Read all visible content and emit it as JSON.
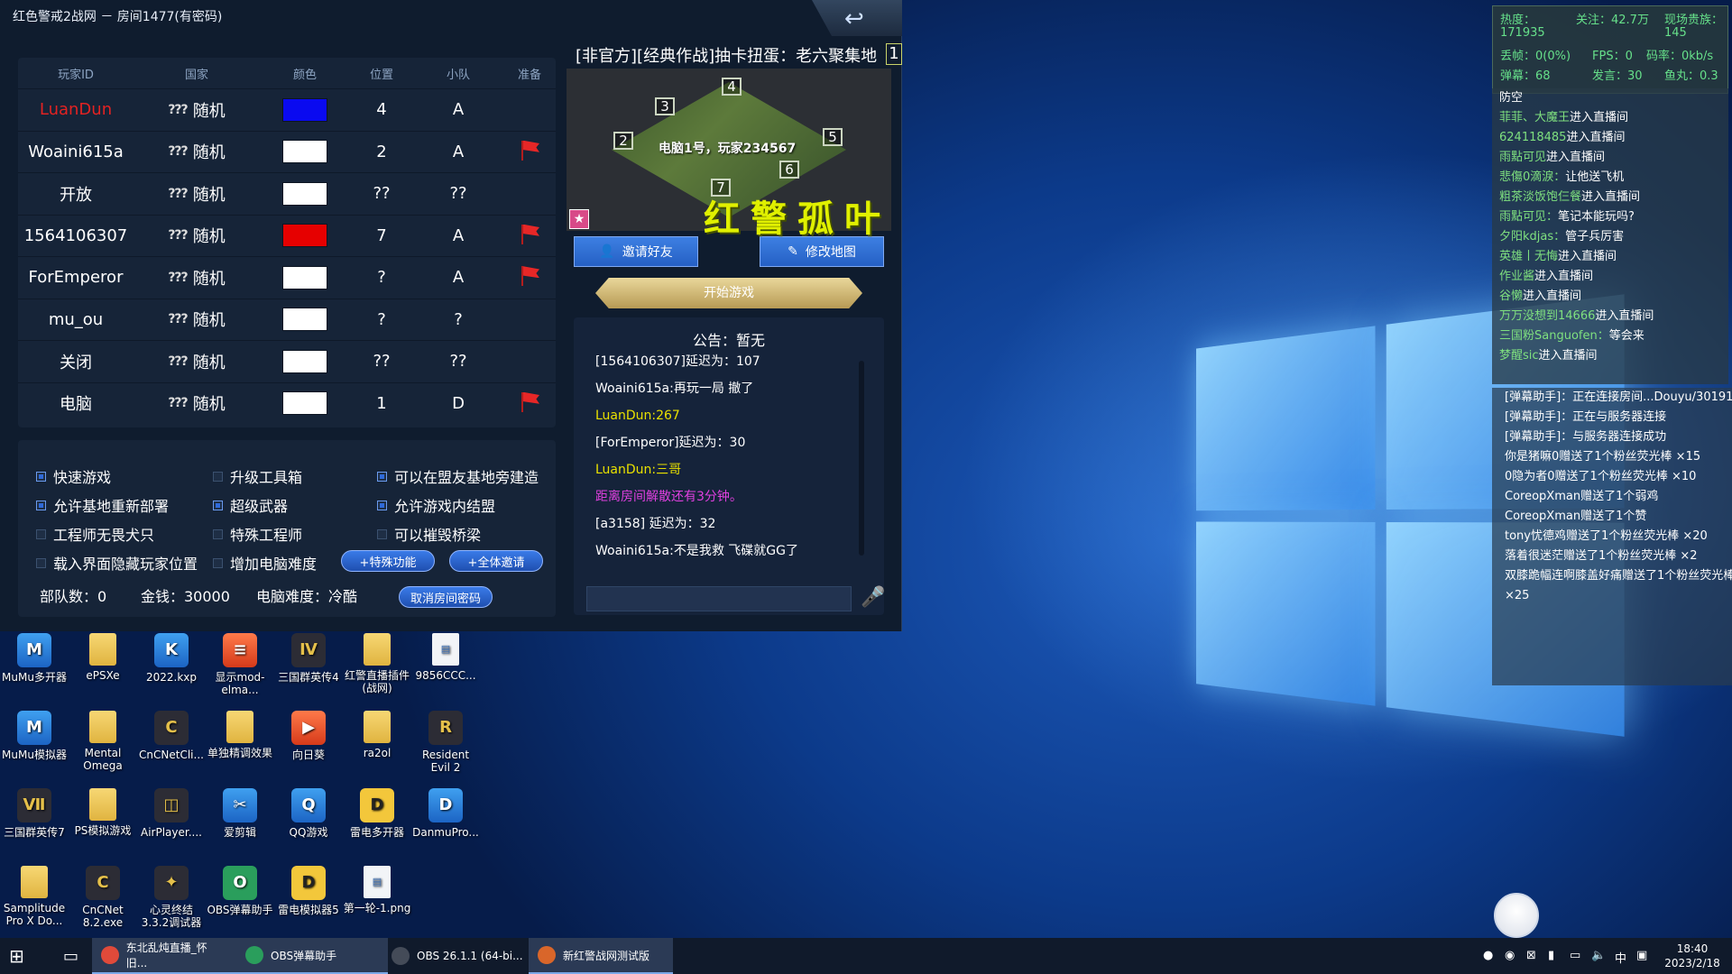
{
  "window": {
    "title": "红色警戒2战网 － 房间1477(有密码)"
  },
  "players": {
    "headers": [
      "玩家ID",
      "国家",
      "颜色",
      "位置",
      "小队",
      "准备"
    ],
    "rows": [
      {
        "id": "LuanDun",
        "country_icon": "???",
        "country": "随机",
        "color": "#0a0af0",
        "pos": "4",
        "team": "A",
        "ready": false,
        "id_color": "#e32222"
      },
      {
        "id": "Woaini615a",
        "country_icon": "???",
        "country": "随机",
        "color": "#ffffff",
        "pos": "2",
        "team": "A",
        "ready": true,
        "id_color": "#ffffff"
      },
      {
        "id": "开放",
        "country_icon": "???",
        "country": "随机",
        "color": "#ffffff",
        "pos": "??",
        "team": "??",
        "ready": false,
        "id_color": "#ffffff"
      },
      {
        "id": "1564106307",
        "country_icon": "???",
        "country": "随机",
        "color": "#e60000",
        "pos": "7",
        "team": "A",
        "ready": true,
        "id_color": "#ffffff"
      },
      {
        "id": "ForEmperor",
        "country_icon": "???",
        "country": "随机",
        "color": "#ffffff",
        "pos": "?",
        "team": "A",
        "ready": true,
        "id_color": "#ffffff"
      },
      {
        "id": "mu_ou",
        "country_icon": "???",
        "country": "随机",
        "color": "#ffffff",
        "pos": "?",
        "team": "?",
        "ready": false,
        "id_color": "#ffffff"
      },
      {
        "id": "关闭",
        "country_icon": "???",
        "country": "随机",
        "color": "#ffffff",
        "pos": "??",
        "team": "??",
        "ready": false,
        "id_color": "#ffffff"
      },
      {
        "id": "电脑",
        "country_icon": "???",
        "country": "随机",
        "color": "#ffffff",
        "pos": "1",
        "team": "D",
        "ready": true,
        "id_color": "#ffffff"
      }
    ]
  },
  "options": [
    {
      "label": "快速游戏",
      "checked": true
    },
    {
      "label": "升级工具箱",
      "checked": false
    },
    {
      "label": "可以在盟友基地旁建造",
      "checked": true
    },
    {
      "label": "允许基地重新部署",
      "checked": true
    },
    {
      "label": "超级武器",
      "checked": true
    },
    {
      "label": "允许游戏内结盟",
      "checked": true
    },
    {
      "label": "工程师无畏犬只",
      "checked": false
    },
    {
      "label": "特殊工程师",
      "checked": false
    },
    {
      "label": "可以摧毁桥梁",
      "checked": false
    },
    {
      "label": "载入界面隐藏玩家位置",
      "checked": false
    },
    {
      "label": "增加电脑难度",
      "checked": false
    }
  ],
  "buttons": {
    "special": "+特殊功能",
    "invite_all": "+全体邀请",
    "cancel_password": "取消房间密码",
    "invite_friend": "邀请好友",
    "edit_map": "修改地图",
    "start_game": "开始游戏"
  },
  "stats": {
    "units": "部队数：0",
    "money": "金钱：30000",
    "ai_difficulty": "电脑难度：冷酷"
  },
  "map": {
    "title": "[非官方][经典作战]抽卡扭蛋：老六聚集地",
    "count": "1",
    "caption": "电脑1号，玩家234567",
    "numbers": [
      "4",
      "3",
      "2",
      "5",
      "6",
      "7"
    ],
    "watermark": "红警孤叶",
    "star": "★"
  },
  "chat": {
    "announcement": "公告：暂无",
    "lines": [
      {
        "text": "[1564106307]延迟为：107",
        "color": "#ffffff"
      },
      {
        "text": "Woaini615a:再玩一局 撤了",
        "color": "#ffffff"
      },
      {
        "text": "LuanDun:267",
        "color": "#e8e000"
      },
      {
        "text": "[ForEmperor]延迟为：30",
        "color": "#ffffff"
      },
      {
        "text": "LuanDun:三哥",
        "color": "#e8e000"
      },
      {
        "text": "距离房间解散还有3分钟。",
        "color": "#e040e0"
      },
      {
        "text": "[a3158] 延迟为：32",
        "color": "#ffffff"
      },
      {
        "text": "Woaini615a:不是我救  飞碟就GG了",
        "color": "#ffffff"
      }
    ]
  },
  "desktop_icons": [
    {
      "label": "MuMu多开器",
      "kind": "app",
      "glyph": "M"
    },
    {
      "label": "ePSXe",
      "kind": "folder",
      "glyph": ""
    },
    {
      "label": "2022.kxp",
      "kind": "app",
      "glyph": "K"
    },
    {
      "label": "显示mod-elma...",
      "kind": "red",
      "glyph": "≡"
    },
    {
      "label": "三国群英传4",
      "kind": "dark",
      "glyph": "Ⅳ"
    },
    {
      "label": "红警直播插件(战网)",
      "kind": "folder",
      "glyph": ""
    },
    {
      "label": "9856CCC...",
      "kind": "file",
      "glyph": "▤"
    },
    {
      "label": "MuMu模拟器",
      "kind": "app",
      "glyph": "M"
    },
    {
      "label": "Mental Omega",
      "kind": "folder",
      "glyph": ""
    },
    {
      "label": "CnCNetCli...",
      "kind": "dark",
      "glyph": "C"
    },
    {
      "label": "单独精调效果",
      "kind": "folder",
      "glyph": ""
    },
    {
      "label": "向日葵",
      "kind": "red",
      "glyph": "▶"
    },
    {
      "label": "ra2ol",
      "kind": "folder",
      "glyph": ""
    },
    {
      "label": "Resident Evil 2",
      "kind": "dark",
      "glyph": "R"
    },
    {
      "label": "三国群英传7",
      "kind": "dark",
      "glyph": "Ⅶ"
    },
    {
      "label": "PS模拟游戏",
      "kind": "folder",
      "glyph": ""
    },
    {
      "label": "AirPlayer....",
      "kind": "dark",
      "glyph": "◫"
    },
    {
      "label": "爱剪辑",
      "kind": "app",
      "glyph": "✂"
    },
    {
      "label": "QQ游戏",
      "kind": "app",
      "glyph": "Q"
    },
    {
      "label": "雷电多开器",
      "kind": "yellow",
      "glyph": "D"
    },
    {
      "label": "DanmuPro...",
      "kind": "app",
      "glyph": "D"
    },
    {
      "label": "Samplitude Pro X Do...",
      "kind": "folder",
      "glyph": ""
    },
    {
      "label": "CnCNet 8.2.exe",
      "kind": "dark",
      "glyph": "C"
    },
    {
      "label": "心灵终结3.3.2调试器",
      "kind": "dark",
      "glyph": "✦"
    },
    {
      "label": "OBS弹幕助手",
      "kind": "green",
      "glyph": "O"
    },
    {
      "label": "雷电模拟器5",
      "kind": "yellow",
      "glyph": "D"
    },
    {
      "label": "第一轮-1.png",
      "kind": "file",
      "glyph": "▤"
    }
  ],
  "stream_stats": {
    "heat": "热度：",
    "heat_val": "171935",
    "follow": "关注：42.7万",
    "nobles": "现场贵族：",
    "nobles_val": "145",
    "drop": "丢帧：0(0%)",
    "fps": "FPS：0",
    "bitrate": "码率：0kb/s",
    "danmu": "弹幕：68",
    "speak": "发言：30",
    "fish": "鱼丸：0.3"
  },
  "live_chat": [
    {
      "user": "",
      "text": "防空",
      "ucolor": ""
    },
    {
      "user": "菲菲、大魔王",
      "text": "进入直播间",
      "ucolor": "u-green"
    },
    {
      "user": "624118485",
      "text": "进入直播间",
      "ucolor": "u-green"
    },
    {
      "user": "雨點可见",
      "text": "进入直播间",
      "ucolor": "u-green"
    },
    {
      "user": "悲傷0滴淚：",
      "text": "让他送飞机",
      "ucolor": "u-green"
    },
    {
      "user": "粗茶淡饭饱仨餐",
      "text": "进入直播间",
      "ucolor": "u-green"
    },
    {
      "user": "雨點可见：",
      "text": "笔记本能玩吗?",
      "ucolor": "u-green"
    },
    {
      "user": "夕阳kdjas：",
      "text": "管子兵厉害",
      "ucolor": "u-green"
    },
    {
      "user": "英雄丨无悔",
      "text": "进入直播间",
      "ucolor": "u-green"
    },
    {
      "user": "作业酱",
      "text": "进入直播间",
      "ucolor": "u-green"
    },
    {
      "user": "谷懒",
      "text": "进入直播间",
      "ucolor": "u-green"
    },
    {
      "user": "万万没想到14666",
      "text": "进入直播间",
      "ucolor": "u-green"
    },
    {
      "user": "三国粉Sanguofen：",
      "text": "等会来",
      "ucolor": "u-green"
    },
    {
      "user": "梦醒sic",
      "text": "进入直播间",
      "ucolor": "u-green"
    }
  ],
  "gifts": [
    {
      "text": "[弹幕助手]：正在连接房间...Douyu/30191",
      "cls": ""
    },
    {
      "text": "[弹幕助手]：正在与服务器连接",
      "cls": ""
    },
    {
      "text": "[弹幕助手]：与服务器连接成功",
      "cls": ""
    },
    {
      "text": "你是猪嘛0赠送了1个粉丝荧光棒 ×15",
      "cls": "g-y"
    },
    {
      "text": "0隐为者0赠送了1个粉丝荧光棒 ×10",
      "cls": "g-y"
    },
    {
      "text": "CoreopXman赠送了1个弱鸡",
      "cls": "g-y"
    },
    {
      "text": "CoreopXman赠送了1个赞",
      "cls": "g-y"
    },
    {
      "text": "tony忧德鸡赠送了1个粉丝荧光棒 ×20",
      "cls": "g-y"
    },
    {
      "text": "落着很迷茫赠送了1个粉丝荧光棒 ×2",
      "cls": "g-y"
    },
    {
      "text": "双膝跪幅连啊膝盖好痛赠送了1个粉丝荧光棒",
      "cls": "g-y"
    },
    {
      "text": "×25",
      "cls": "g-y"
    }
  ],
  "taskbar": {
    "items": [
      {
        "label": "东北乱炖直播_怀旧...",
        "color": "#e04a3a",
        "active": true
      },
      {
        "label": "OBS弹幕助手",
        "color": "#2a9e5c",
        "active": true
      },
      {
        "label": "OBS 26.1.1 (64-bi...",
        "color": "#444b58",
        "active": false
      },
      {
        "label": "新红警战网测试版",
        "color": "#d9662a",
        "active": true
      }
    ],
    "time": "18:40",
    "date": "2023/2/18",
    "ime": "中"
  }
}
